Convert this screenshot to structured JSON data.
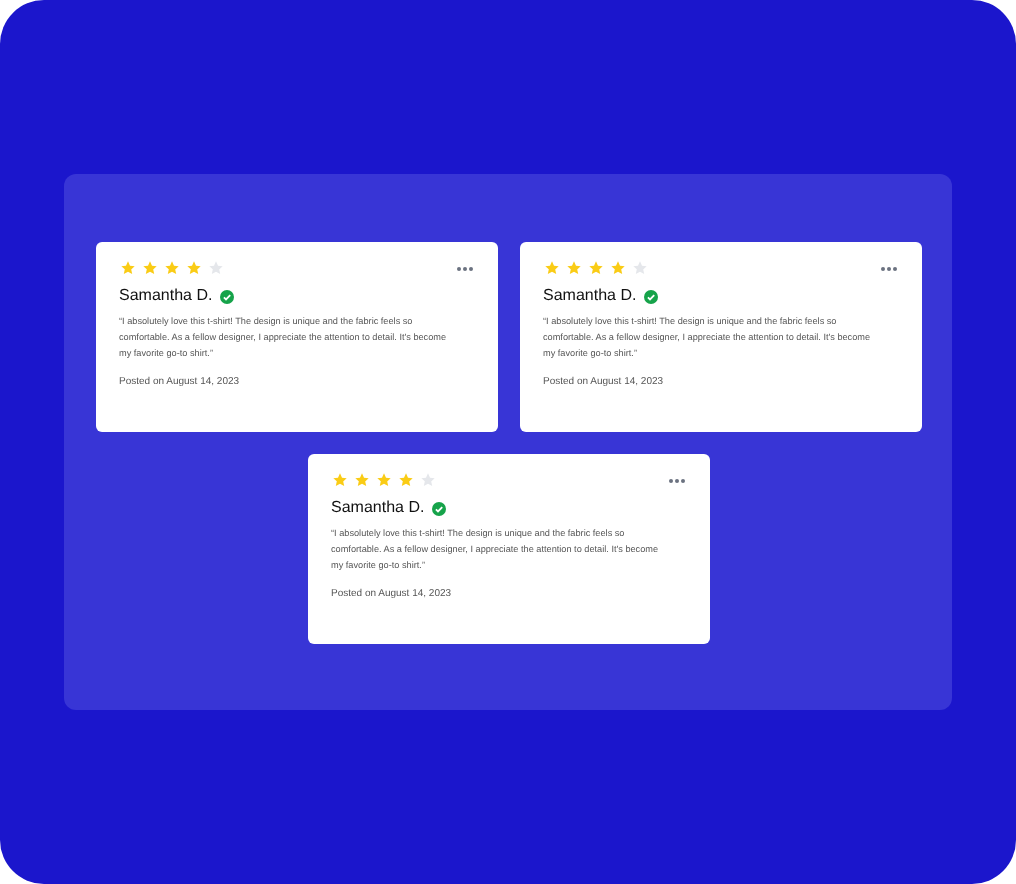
{
  "reviews": [
    {
      "stars": 4,
      "name": "Samantha D.",
      "verified": true,
      "text": "“I absolutely love this t-shirt! The design is unique and the fabric feels so comfortable. As a fellow designer, I appreciate the attention to detail. It's become my favorite go-to shirt.”",
      "date": "Posted on August 14, 2023"
    },
    {
      "stars": 4,
      "name": "Samantha D.",
      "verified": true,
      "text": "“I absolutely love this t-shirt! The design is unique and the fabric feels so comfortable. As a fellow designer, I appreciate the attention to detail. It's become my favorite go-to shirt.”",
      "date": "Posted on August 14, 2023"
    },
    {
      "stars": 4,
      "name": "Samantha D.",
      "verified": true,
      "text": "“I absolutely love this t-shirt! The design is unique and the fabric feels so comfortable. As a fellow designer, I appreciate the attention to detail. It's become my favorite go-to shirt.”",
      "date": "Posted on August 14, 2023"
    }
  ]
}
